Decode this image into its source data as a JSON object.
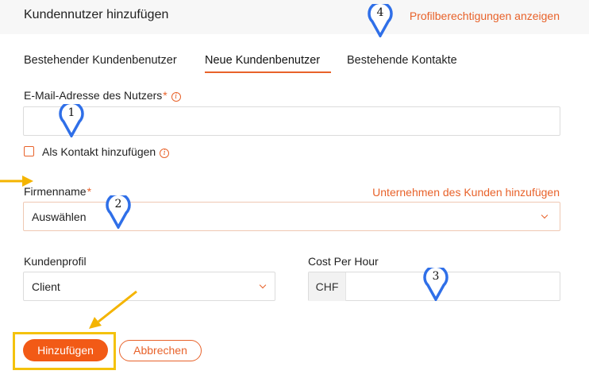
{
  "header": {
    "title": "Kundennutzer hinzufügen",
    "link": "Profilberechtigungen anzeigen"
  },
  "tabs": [
    {
      "label": "Bestehender Kundenbenutzer",
      "active": false
    },
    {
      "label": "Neue Kundenbenutzer",
      "active": true
    },
    {
      "label": "Bestehende Kontakte",
      "active": false
    }
  ],
  "form": {
    "email": {
      "label": "E-Mail-Adresse des Nutzers",
      "required": "*",
      "value": ""
    },
    "add_contact": {
      "label": "Als Kontakt hinzufügen",
      "checked": false
    },
    "company": {
      "label": "Firmenname",
      "required": "*",
      "add_link": "Unternehmen des Kunden hinzufügen",
      "value": "Auswählen"
    },
    "profile": {
      "label": "Kundenprofil",
      "value": "Client"
    },
    "cost": {
      "label": "Cost Per Hour",
      "currency": "CHF",
      "value": ""
    }
  },
  "buttons": {
    "submit": "Hinzufügen",
    "cancel": "Abbrechen"
  },
  "annotations": {
    "markers": [
      "1",
      "2",
      "3",
      "4"
    ],
    "accent_colors": {
      "marker": "#2f6fe8",
      "arrow": "#f4b400",
      "brand": "#e8622a"
    }
  }
}
